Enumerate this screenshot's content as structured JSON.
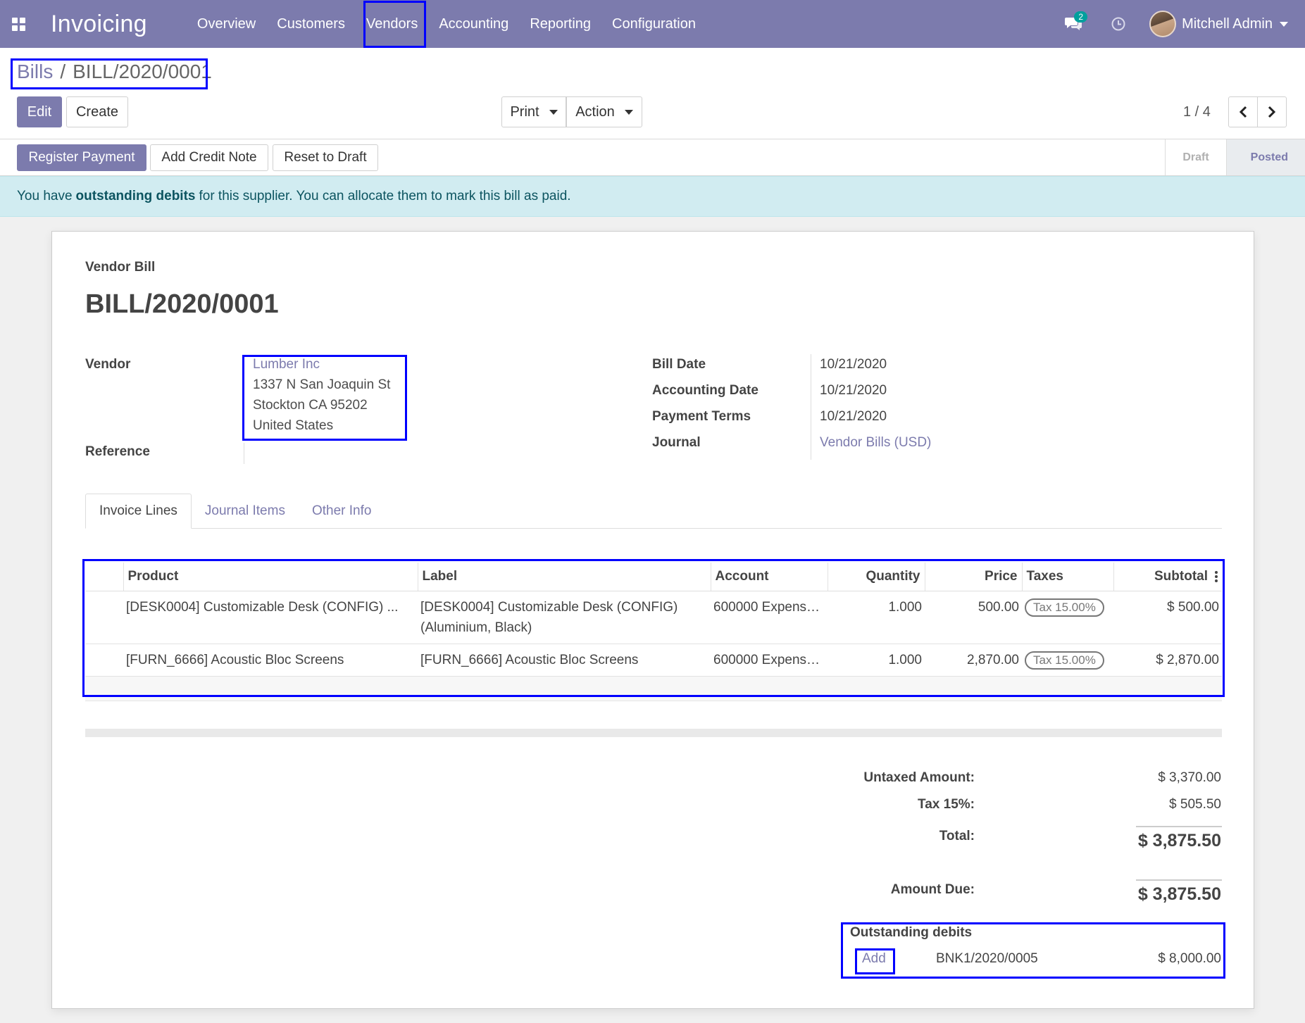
{
  "navbar": {
    "app_title": "Invoicing",
    "menu": [
      "Overview",
      "Customers",
      "Vendors",
      "Accounting",
      "Reporting",
      "Configuration"
    ],
    "chat_count": "2",
    "user_name": "Mitchell Admin"
  },
  "breadcrumb": {
    "parent": "Bills",
    "separator": "/",
    "current": "BILL/2020/0001"
  },
  "buttons": {
    "edit": "Edit",
    "create": "Create",
    "print": "Print",
    "action": "Action"
  },
  "pager": {
    "text": "1 / 4"
  },
  "statusbar": {
    "register_payment": "Register Payment",
    "add_credit_note": "Add Credit Note",
    "reset_to_draft": "Reset to Draft",
    "stages": [
      "Draft",
      "Posted"
    ],
    "active_stage": "Posted"
  },
  "alert": {
    "prefix": "You have",
    "bold": "outstanding debits",
    "suffix": "for this supplier. You can allocate them to mark this bill as paid."
  },
  "doc": {
    "type": "Vendor Bill",
    "number": "BILL/2020/0001",
    "vendor_label": "Vendor",
    "vendor_name": "Lumber Inc",
    "vendor_address": [
      "1337 N San Joaquin St",
      "Stockton CA 95202",
      "United States"
    ],
    "reference_label": "Reference",
    "reference_value": "",
    "bill_date_label": "Bill Date",
    "bill_date": "10/21/2020",
    "accounting_date_label": "Accounting Date",
    "accounting_date": "10/21/2020",
    "payment_terms_label": "Payment Terms",
    "payment_terms": "10/21/2020",
    "journal_label": "Journal",
    "journal": "Vendor Bills (USD)"
  },
  "tabs": [
    "Invoice Lines",
    "Journal Items",
    "Other Info"
  ],
  "lines": {
    "headers": [
      "Product",
      "Label",
      "Account",
      "Quantity",
      "Price",
      "Taxes",
      "Subtotal"
    ],
    "rows": [
      {
        "product": "[DESK0004] Customizable Desk (CONFIG) ...",
        "label_line1": "[DESK0004] Customizable Desk (CONFIG)",
        "label_line2": "(Aluminium, Black)",
        "account": "600000 Expens…",
        "quantity": "1.000",
        "price": "500.00",
        "tax": "Tax 15.00%",
        "subtotal": "$ 500.00"
      },
      {
        "product": "[FURN_6666] Acoustic Bloc Screens",
        "label_line1": "[FURN_6666] Acoustic Bloc Screens",
        "label_line2": "",
        "account": "600000 Expens…",
        "quantity": "1.000",
        "price": "2,870.00",
        "tax": "Tax 15.00%",
        "subtotal": "$ 2,870.00"
      }
    ]
  },
  "totals": {
    "untaxed_label": "Untaxed Amount:",
    "untaxed": "$ 3,370.00",
    "tax_label": "Tax 15%:",
    "tax": "$ 505.50",
    "total_label": "Total:",
    "total": "$ 3,875.50",
    "due_label": "Amount Due:",
    "due": "$ 3,875.50"
  },
  "outstanding": {
    "title": "Outstanding debits",
    "add": "Add",
    "reference": "BNK1/2020/0005",
    "amount": "$ 8,000.00"
  },
  "colors": {
    "brand": "#7c7bad",
    "alert_bg": "#d1ecf1",
    "alert_text": "#0c5460",
    "highlight": "#0000ff"
  }
}
